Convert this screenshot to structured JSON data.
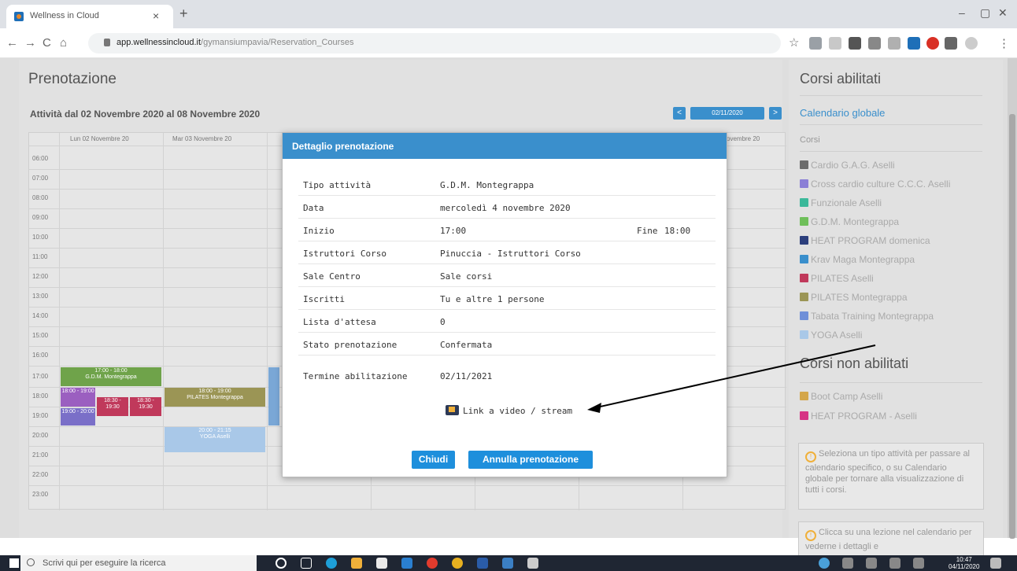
{
  "browser": {
    "tab_title": "Wellness in Cloud",
    "tab_close": "×",
    "new_tab": "+",
    "url_domain": "app.wellnessincloud.it",
    "url_path": "/gymansiumpavia/Reservation_Courses",
    "window_min": "–",
    "window_max": "▢",
    "window_close": "✕",
    "star": "☆",
    "menu": "⋮"
  },
  "page": {
    "title": "Prenotazione",
    "range_label": "Attività dal 02 Novembre 2020 al 08 Novembre 2020",
    "prev": "<",
    "date_field": "02/11/2020",
    "next": ">"
  },
  "calendar": {
    "day_headers": [
      "Lun 02 Novembre 20",
      "Mar 03 Novembre 20",
      "ovembre 20"
    ],
    "times": [
      "06:00",
      "07:00",
      "08:00",
      "09:00",
      "10:00",
      "11:00",
      "12:00",
      "13:00",
      "14:00",
      "15:00",
      "16:00",
      "17:00",
      "18:00",
      "19:00",
      "20:00",
      "21:00",
      "22:00",
      "23:00"
    ],
    "events": [
      {
        "time": "17:00 - 18:00",
        "name": "G.D.M. Montegrappa",
        "color": "#6fa34a"
      },
      {
        "time": "18:00 - 19:00",
        "name": "",
        "color": "#9b5fc0"
      },
      {
        "time": "18:30 - 19:30",
        "name": "",
        "color": "#c0395b"
      },
      {
        "time": "18:30 - 19:30",
        "name": "",
        "color": "#c0395b"
      },
      {
        "time": "19:00 - 20:00",
        "name": "",
        "color": "#7a6fc8"
      },
      {
        "time": "18:00 - 19:00",
        "name": "PILATES Montegrappa",
        "color": "#9b9555"
      },
      {
        "time": "20:00 - 21:15",
        "name": "YOGA Aselli",
        "color": "#a9c8e8"
      }
    ]
  },
  "sidebar": {
    "title": "Corsi abilitati",
    "global_link": "Calendario globale",
    "courses_label": "Corsi",
    "courses": [
      {
        "name": "Cardio G.A.G. Aselli",
        "color": "#6b6b6b"
      },
      {
        "name": "Cross cardio culture C.C.C. Aselli",
        "color": "#8b7fd6"
      },
      {
        "name": "Funzionale Aselli",
        "color": "#3bb89a"
      },
      {
        "name": "G.D.M. Montegrappa",
        "color": "#6fbf5a"
      },
      {
        "name": "HEAT PROGRAM domenica",
        "color": "#2c3f7c"
      },
      {
        "name": "Krav Maga Montegrappa",
        "color": "#3a8fcc"
      },
      {
        "name": "PILATES Aselli",
        "color": "#c0395b"
      },
      {
        "name": "PILATES Montegrappa",
        "color": "#9b9555"
      },
      {
        "name": "Tabata Training Montegrappa",
        "color": "#6f8fd8"
      },
      {
        "name": "YOGA Aselli",
        "color": "#a9c8e8"
      }
    ],
    "disabled_title": "Corsi non abilitati",
    "disabled": [
      {
        "name": "Boot Camp Aselli",
        "color": "#d4a64a"
      },
      {
        "name": "HEAT PROGRAM - Aselli",
        "color": "#d63384"
      }
    ],
    "hint1": "Seleziona un tipo attività per passare al calendario specifico, o su Calendario globale per tornare alla visualizzazione di tutti i corsi.",
    "hint2": "Clicca su una lezione nel calendario per vederne i dettagli e"
  },
  "modal": {
    "title": "Dettaglio prenotazione",
    "rows": [
      {
        "label": "Tipo attività",
        "value": "G.D.M. Montegrappa"
      },
      {
        "label": "Data",
        "value": "mercoledì 4 novembre 2020"
      },
      {
        "label": "Inizio",
        "value": "17:00"
      },
      {
        "label": "Istruttori Corso",
        "value": "Pinuccia - Istruttori Corso"
      },
      {
        "label": "Sale Centro",
        "value": "Sale corsi"
      },
      {
        "label": "Iscritti",
        "value": "Tu e altre 1 persone"
      },
      {
        "label": "Lista d'attesa",
        "value": "0"
      },
      {
        "label": "Stato prenotazione",
        "value": "Confermata"
      },
      {
        "label": "Termine abilitazione",
        "value": "02/11/2021"
      }
    ],
    "fine_label": "Fine",
    "fine_value": "18:00",
    "video_link": "Link a video / stream",
    "close_button": "Chiudi",
    "cancel_button": "Annulla prenotazione"
  },
  "taskbar": {
    "search_placeholder": "Scrivi qui per eseguire la ricerca",
    "time": "10:47",
    "date": "04/11/2020"
  }
}
